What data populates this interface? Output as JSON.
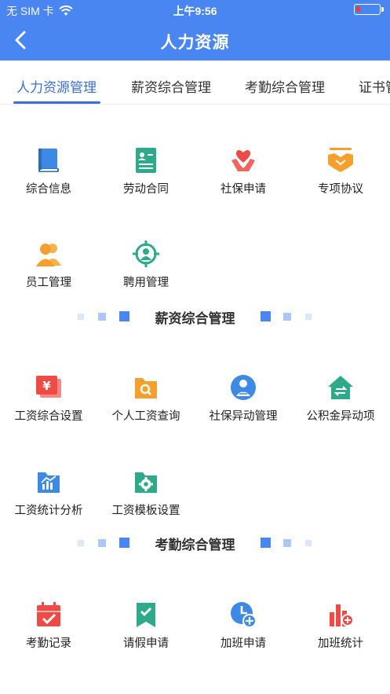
{
  "status": {
    "carrier": "无 SIM 卡",
    "time": "上午9:56"
  },
  "nav": {
    "title": "人力资源"
  },
  "tabs": [
    "人力资源管理",
    "薪资综合管理",
    "考勤综合管理",
    "证书管理"
  ],
  "hr_items": [
    {
      "label": "综合信息",
      "icon": "book-icon"
    },
    {
      "label": "劳动合同",
      "icon": "contract-icon"
    },
    {
      "label": "社保申请",
      "icon": "heart-hands-icon"
    },
    {
      "label": "专项协议",
      "icon": "handshake-icon"
    },
    {
      "label": "员工管理",
      "icon": "people-icon"
    },
    {
      "label": "聘用管理",
      "icon": "target-person-icon"
    }
  ],
  "salary_section": {
    "title": "薪资综合管理"
  },
  "salary_items": [
    {
      "label": "工资综合设置",
      "icon": "yen-card-icon"
    },
    {
      "label": "个人工资查询",
      "icon": "folder-search-icon"
    },
    {
      "label": "社保异动管理",
      "icon": "person-exchange-icon"
    },
    {
      "label": "公积金异动项",
      "icon": "house-exchange-icon"
    },
    {
      "label": "工资统计分析",
      "icon": "chart-folder-icon"
    },
    {
      "label": "工资模板设置",
      "icon": "gear-folder-icon"
    }
  ],
  "attendance_section": {
    "title": "考勤综合管理"
  },
  "attendance_items": [
    {
      "label": "考勤记录",
      "icon": "calendar-check-icon"
    },
    {
      "label": "请假申请",
      "icon": "bookmark-check-icon"
    },
    {
      "label": "加班申请",
      "icon": "clock-plus-icon"
    },
    {
      "label": "加班统计",
      "icon": "bar-plus-icon"
    }
  ],
  "colors": {
    "primary": "#4a86f2",
    "tab_active": "#3b6fd8",
    "blue_icon": "#3d8ae6",
    "teal_icon": "#2eaa8a",
    "red_icon": "#ef4a45",
    "orange_icon": "#f5a02c"
  }
}
